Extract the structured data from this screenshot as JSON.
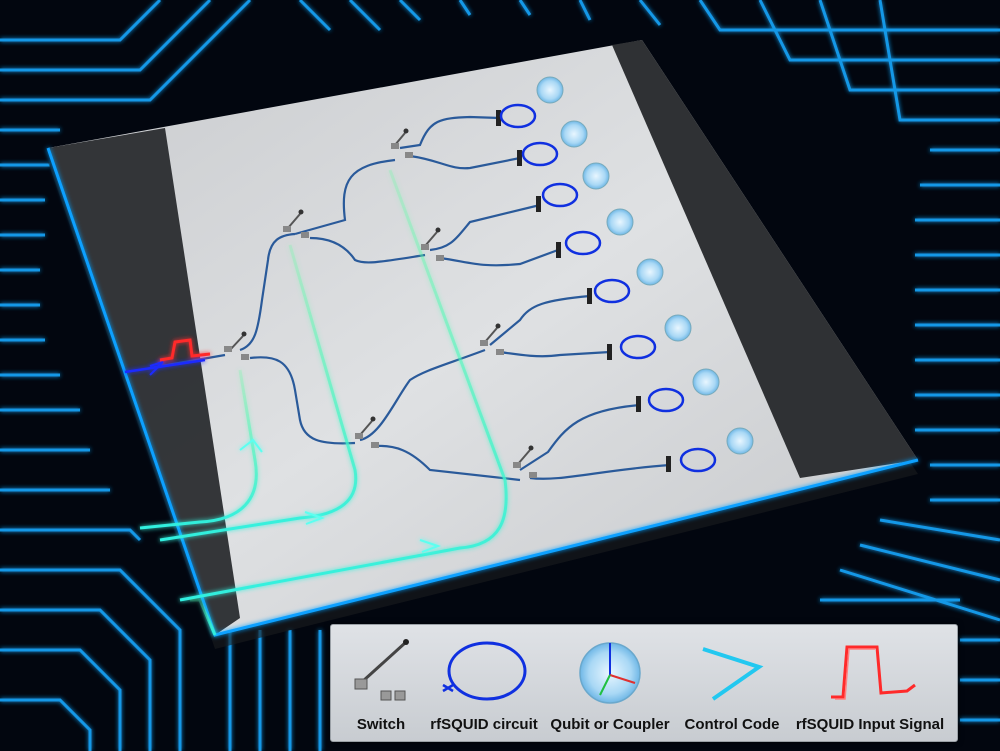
{
  "colors": {
    "background": "#02060f",
    "board_trace": "#18a8ff",
    "chip": "#d2d4d6",
    "chip_edge": "#2a2c2f",
    "wire": "#2a5a9a",
    "rfsquid_loop": "#1030e0",
    "control_line": "#2ef2d8",
    "input_signal": "#ff2a2a"
  },
  "legend": {
    "items": [
      {
        "icon": "switch-icon",
        "label": "Switch"
      },
      {
        "icon": "rfsquid-circuit-icon",
        "label": "rfSQUID circuit"
      },
      {
        "icon": "qubit-coupler-icon",
        "label": "Qubit or Coupler"
      },
      {
        "icon": "control-code-icon",
        "label": "Control Code"
      },
      {
        "icon": "input-signal-icon",
        "label": "rfSQUID Input Signal"
      }
    ]
  }
}
